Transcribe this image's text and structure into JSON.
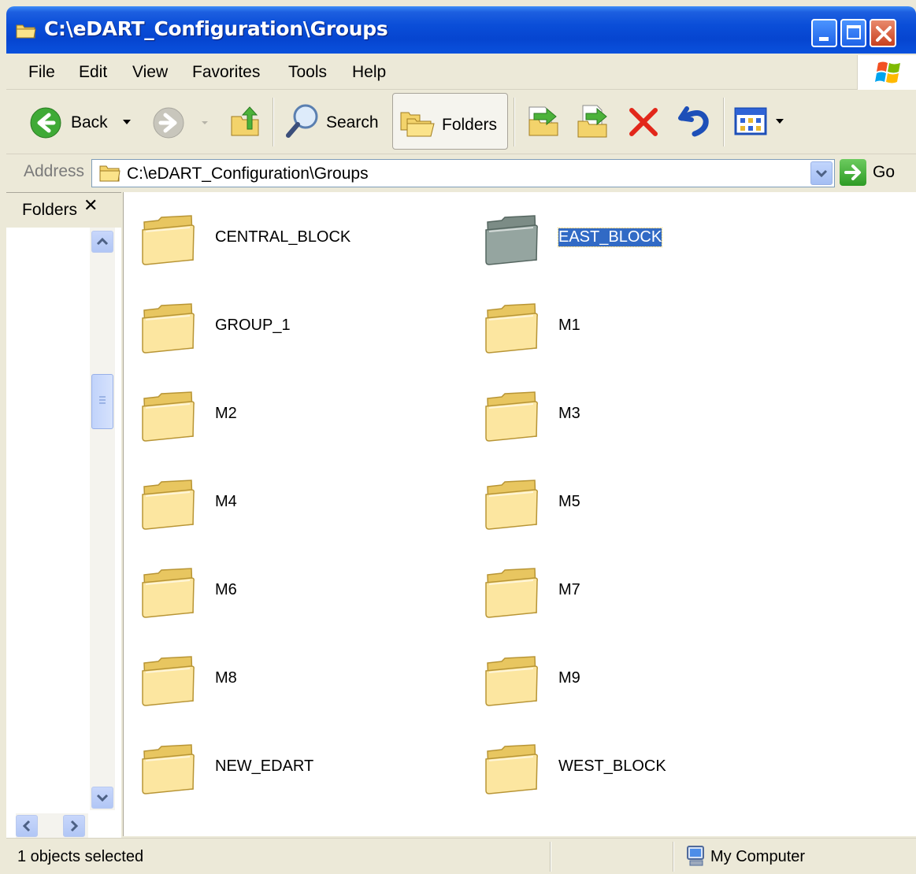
{
  "window": {
    "title": "C:\\eDART_Configuration\\Groups",
    "title_color": "#0A4ED8"
  },
  "menu": {
    "items": [
      "File",
      "Edit",
      "View",
      "Favorites",
      "Tools",
      "Help"
    ]
  },
  "toolbar": {
    "back_label": "Back",
    "search_label": "Search",
    "folders_label": "Folders"
  },
  "address": {
    "label": "Address",
    "value": "C:\\eDART_Configuration\\Groups",
    "go_label": "Go"
  },
  "pane": {
    "title": "Folders",
    "close_glyph": "✕"
  },
  "folders": [
    {
      "name": "CENTRAL_BLOCK",
      "selected": false
    },
    {
      "name": "EAST_BLOCK",
      "selected": true
    },
    {
      "name": "GROUP_1",
      "selected": false
    },
    {
      "name": "M1",
      "selected": false
    },
    {
      "name": "M2",
      "selected": false
    },
    {
      "name": "M3",
      "selected": false
    },
    {
      "name": "M4",
      "selected": false
    },
    {
      "name": "M5",
      "selected": false
    },
    {
      "name": "M6",
      "selected": false
    },
    {
      "name": "M7",
      "selected": false
    },
    {
      "name": "M8",
      "selected": false
    },
    {
      "name": "M9",
      "selected": false
    },
    {
      "name": "NEW_EDART",
      "selected": false
    },
    {
      "name": "WEST_BLOCK",
      "selected": false
    }
  ],
  "status": {
    "left": "1 objects selected",
    "right": "My Computer"
  },
  "colors": {
    "selection": "#316AC5",
    "folder": "#F6D56B"
  }
}
